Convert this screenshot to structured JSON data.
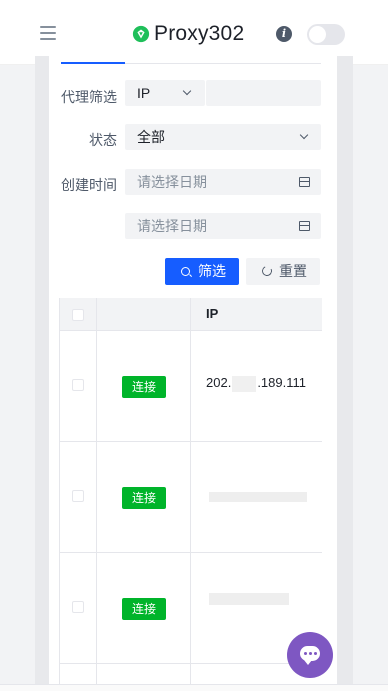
{
  "header": {
    "brand": "Proxy302",
    "brand_color": "#1d2129",
    "logo_color": "#1fbf5a"
  },
  "filters": {
    "proxy_label": "代理筛选",
    "proxy_type": "IP",
    "status_label": "状态",
    "status_value": "全部",
    "created_label": "创建时间",
    "date_start_placeholder": "请选择日期",
    "date_end_placeholder": "请选择日期"
  },
  "actions": {
    "filter_label": "筛选",
    "reset_label": "重置",
    "primary_color": "#165dff"
  },
  "table": {
    "columns": [
      "",
      "",
      "IP"
    ],
    "rows": [
      {
        "action": "连接",
        "ip_prefix": "202.",
        "ip_suffix": ".189.111"
      },
      {
        "action": "连接",
        "ip_prefix": "",
        "ip_suffix": ""
      },
      {
        "action": "连接",
        "ip_prefix": "",
        "ip_suffix": ""
      }
    ],
    "tag_color": "#00b42a"
  },
  "icons": [
    "menu-icon",
    "logo-icon",
    "info-icon",
    "toggle-switch",
    "chevron-down-icon",
    "calendar-icon",
    "search-icon",
    "reload-icon",
    "chat-icon"
  ]
}
